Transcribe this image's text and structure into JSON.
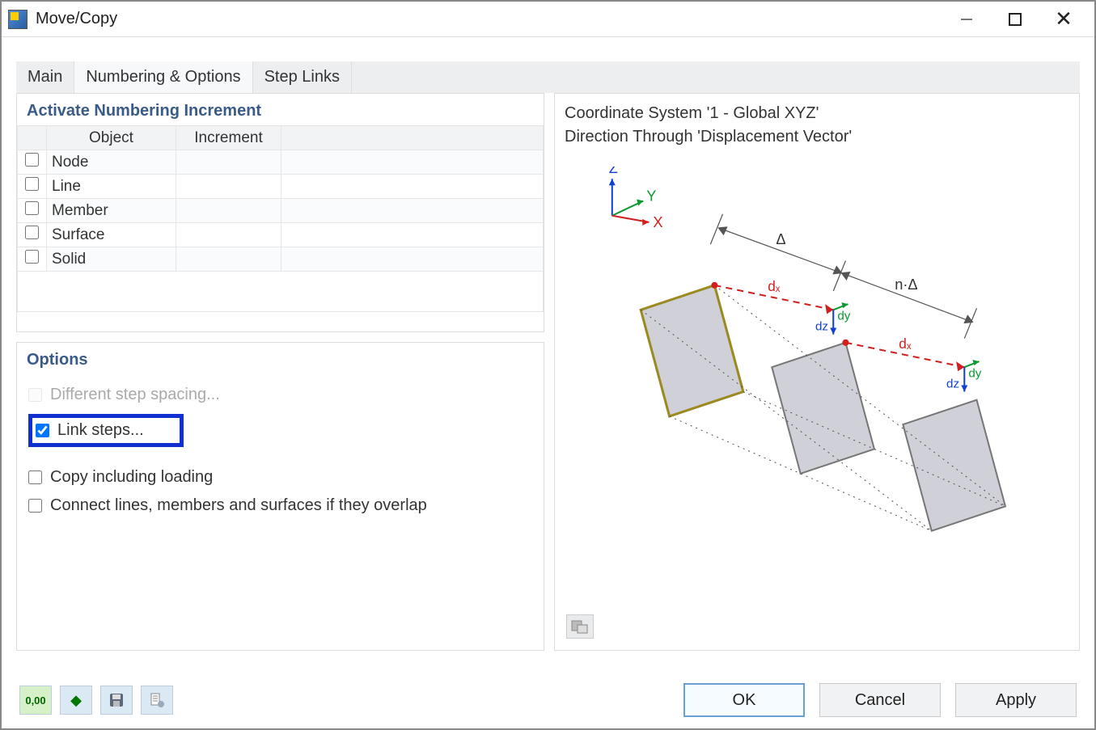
{
  "window": {
    "title": "Move/Copy"
  },
  "tabs": {
    "main": "Main",
    "numbering": "Numbering & Options",
    "step_links": "Step Links"
  },
  "numbering": {
    "group_title": "Activate Numbering Increment",
    "headers": {
      "object": "Object",
      "increment": "Increment"
    },
    "rows": [
      {
        "label": "Node"
      },
      {
        "label": "Line"
      },
      {
        "label": "Member"
      },
      {
        "label": "Surface"
      },
      {
        "label": "Solid"
      }
    ]
  },
  "options": {
    "group_title": "Options",
    "diff_step": "Different step spacing...",
    "link_steps": "Link steps...",
    "copy_loading": "Copy including loading",
    "connect": "Connect lines, members and surfaces if they overlap"
  },
  "preview": {
    "line1": "Coordinate System '1 - Global XYZ'",
    "line2": "Direction Through 'Displacement Vector'",
    "labels": {
      "z": "Z",
      "y": "Y",
      "x": "X",
      "delta": "Δ",
      "ndelta": "n·Δ",
      "dx": "dₓ",
      "dy": "dy",
      "dz": "dz"
    }
  },
  "toolbar": {
    "decimals": "0,00",
    "pick": "⬛",
    "save": "💾",
    "list": "📄"
  },
  "buttons": {
    "ok": "OK",
    "cancel": "Cancel",
    "apply": "Apply"
  }
}
